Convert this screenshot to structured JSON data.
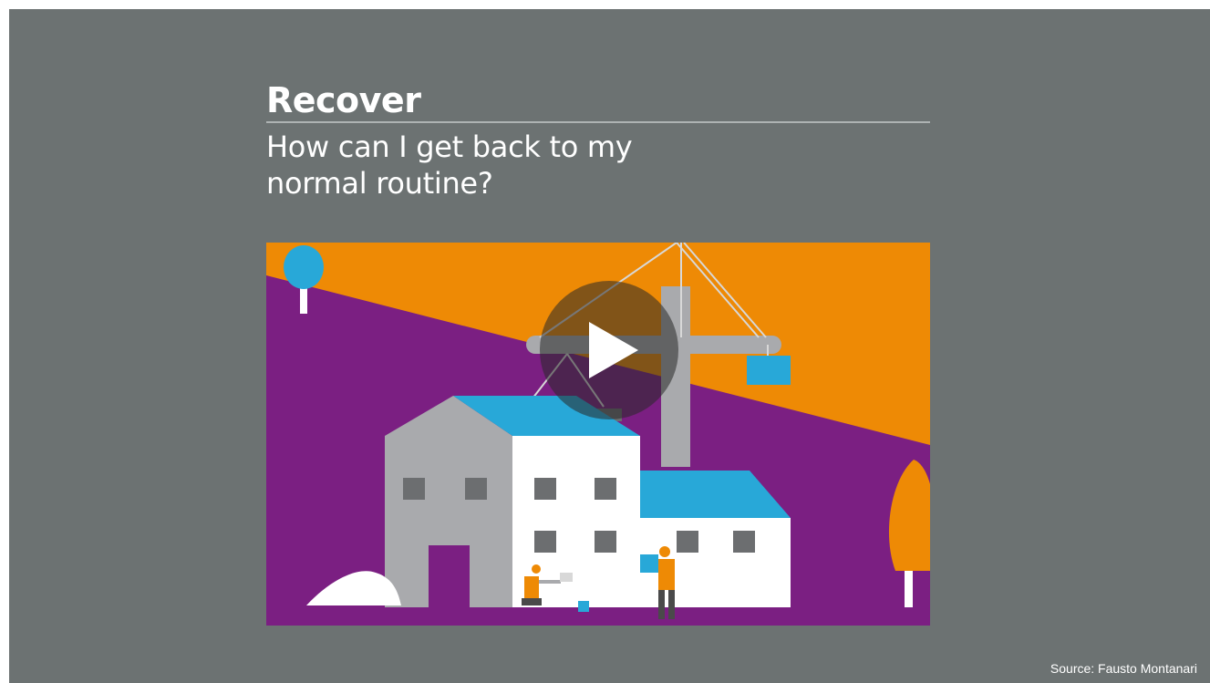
{
  "slide": {
    "title": "Recover",
    "subtitle": "How can I get back to my normal routine?",
    "source": "Source: Fausto Montanari"
  },
  "video": {
    "illustration": "construction-site-illustration",
    "play_icon": "play-icon"
  },
  "colors": {
    "background": "#6c7272",
    "orange": "#ee8a05",
    "purple": "#7b1f82",
    "blue": "#28a8d8",
    "gray": "#a9aaad",
    "white": "#ffffff"
  }
}
